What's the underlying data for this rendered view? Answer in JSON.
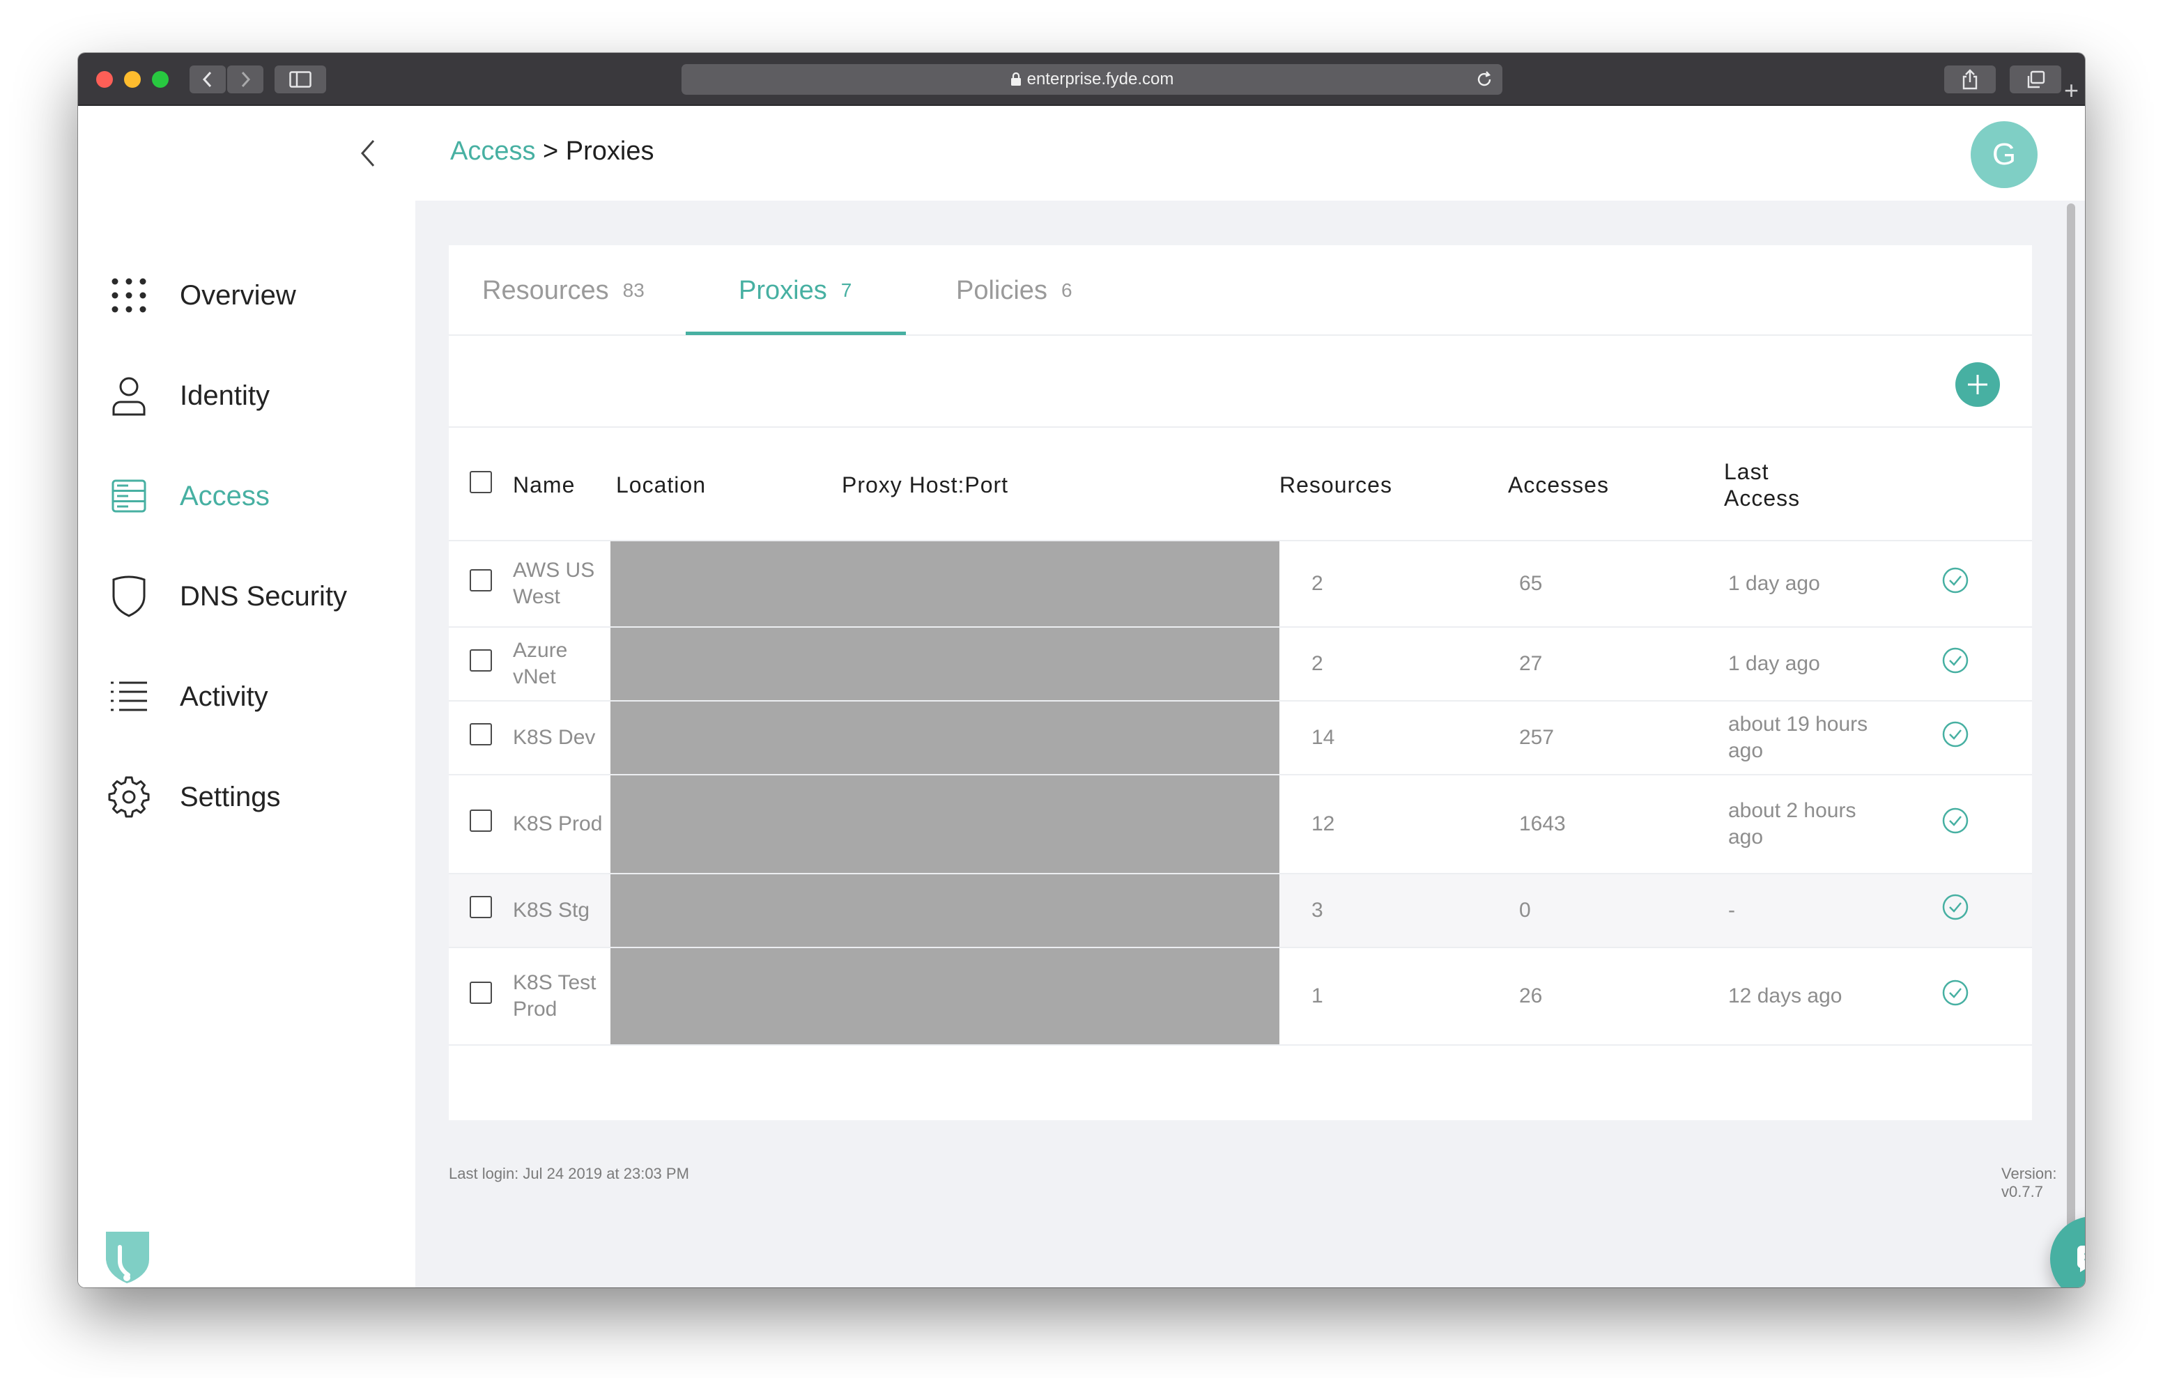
{
  "browser": {
    "url": "enterprise.fyde.com"
  },
  "header": {
    "breadcrumb_parent": "Access",
    "breadcrumb_separator": " > ",
    "breadcrumb_current": "Proxies",
    "avatar_initial": "G"
  },
  "sidebar": {
    "items": [
      {
        "label": "Overview",
        "icon": "grid-dots-icon",
        "active": false
      },
      {
        "label": "Identity",
        "icon": "user-icon",
        "active": false
      },
      {
        "label": "Access",
        "icon": "server-icon",
        "active": true
      },
      {
        "label": "DNS Security",
        "icon": "shield-icon",
        "active": false
      },
      {
        "label": "Activity",
        "icon": "list-icon",
        "active": false
      },
      {
        "label": "Settings",
        "icon": "gear-icon",
        "active": false
      }
    ]
  },
  "tabs": [
    {
      "label": "Resources",
      "count": "83",
      "active": false
    },
    {
      "label": "Proxies",
      "count": "7",
      "active": true
    },
    {
      "label": "Policies",
      "count": "6",
      "active": false
    }
  ],
  "table": {
    "columns": [
      "Name",
      "Location",
      "Proxy Host:Port",
      "Resources",
      "Accesses",
      "Last Access"
    ],
    "rows": [
      {
        "name": "AWS US West",
        "resources": "2",
        "accesses": "65",
        "last_access": "1 day ago"
      },
      {
        "name": "Azure vNet",
        "resources": "2",
        "accesses": "27",
        "last_access": "1 day ago"
      },
      {
        "name": "K8S Dev",
        "resources": "14",
        "accesses": "257",
        "last_access": "about 19 hours ago"
      },
      {
        "name": "K8S Prod",
        "resources": "12",
        "accesses": "1643",
        "last_access": "about 2 hours ago"
      },
      {
        "name": "K8S Stg",
        "resources": "3",
        "accesses": "0",
        "last_access": "-"
      },
      {
        "name": "K8S Test Prod",
        "resources": "1",
        "accesses": "26",
        "last_access": "12 days ago"
      }
    ]
  },
  "footer": {
    "last_login": "Last login: Jul 24 2019 at 23:03 PM",
    "version": "Version: v0.7.7"
  },
  "colors": {
    "accent": "#47b0a2",
    "avatar_bg": "#7fcfc5",
    "redaction": "#a8a8a8"
  }
}
